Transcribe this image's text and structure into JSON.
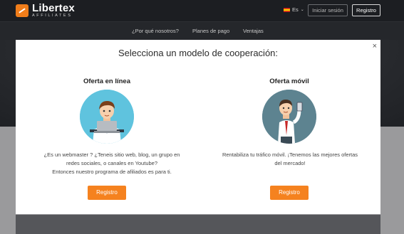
{
  "header": {
    "logo_name": "Libertex",
    "logo_sub": "AFFILIATES",
    "language": "Es",
    "login_label": "Iniciar sesión",
    "register_label": "Registro"
  },
  "nav": {
    "items": [
      {
        "label": "¿Por qué nosotros?"
      },
      {
        "label": "Planes de pago"
      },
      {
        "label": "Ventajas"
      }
    ]
  },
  "modal": {
    "title": "Selecciona un modelo de cooperación:",
    "close": "×",
    "options": [
      {
        "title": "Oferta en línea",
        "description_lines": [
          "¿Es un webmaster ? ¿Teneis sitio web, blog, un grupo en",
          "redes sociales, o canales en Youtube?",
          "Entonces nuestro programa de afiliados es para ti."
        ],
        "button": "Registro"
      },
      {
        "title": "Oferta móvil",
        "description_lines": [
          "Rentabiliza tu tráfico móvil. ¡Tenemos las mejores ofertas",
          "del mercado!"
        ],
        "button": "Registro"
      }
    ]
  },
  "colors": {
    "accent": "#f5821f",
    "online_circle": "#5fc3de",
    "mobile_circle": "#5d8390"
  }
}
